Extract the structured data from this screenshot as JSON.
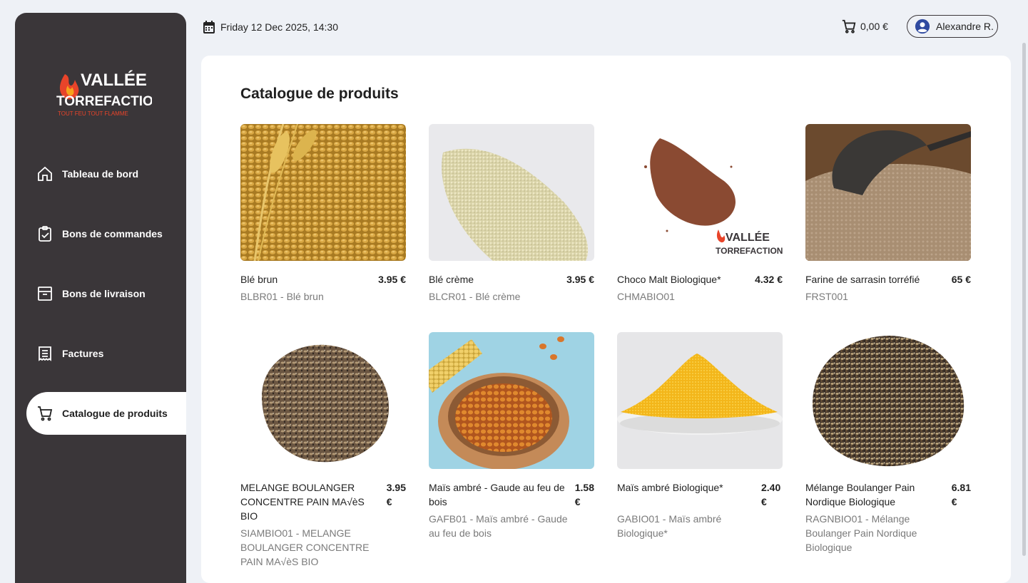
{
  "header": {
    "date": "Friday 12 Dec 2025, 14:30",
    "cart_total": "0,00 €",
    "user_name": "Alexandre R."
  },
  "brand": {
    "line1": "VALLÉE",
    "line2": "TORREFACTION",
    "tagline": "TOUT FEU TOUT FLAMME"
  },
  "sidebar": {
    "items": [
      {
        "label": "Tableau de bord",
        "icon": "home-icon"
      },
      {
        "label": "Bons de commandes",
        "icon": "clipboard-check-icon"
      },
      {
        "label": "Bons de livraison",
        "icon": "archive-box-icon"
      },
      {
        "label": "Factures",
        "icon": "receipt-icon"
      },
      {
        "label": "Catalogue de produits",
        "icon": "cart-icon",
        "active": true
      }
    ]
  },
  "page": {
    "title": "Catalogue de produits"
  },
  "products": [
    {
      "name": "Blé brun",
      "price": "3.95 €",
      "ref": "BLBR01 - Blé brun",
      "image": "golden-wheat-grains"
    },
    {
      "name": "Blé crème",
      "price": "3.95 €",
      "ref": "BLCR01 - Blé crème",
      "image": "cream-wheat-semolina"
    },
    {
      "name": "Choco Malt Biologique*",
      "price": "4.32 €",
      "ref": "CHMABIO01",
      "image": "cocoa-malt-powder"
    },
    {
      "name": "Farine de sarrasin torréfié",
      "price": "65 €",
      "ref": "FRST001",
      "image": "buckwheat-flour"
    },
    {
      "name": "MELANGE BOULANGER CONCENTRE PAIN MA√èS BIO",
      "price": "3.95 €",
      "ref": "SIAMBIO01 - MELANGE BOULANGER CONCENTRE PAIN MA√èS BIO",
      "image": "seed-mix-pile"
    },
    {
      "name": "Maïs ambré - Gaude au feu de bois",
      "price": "1.58 €",
      "ref": "GAFB01 - Maïs ambré - Gaude au feu de bois",
      "image": "roasted-corn-bowl"
    },
    {
      "name": "Maïs ambré Biologique*",
      "price": "2.40 €",
      "ref": "GABIO01 - Maïs ambré Biologique*",
      "image": "yellow-cornmeal"
    },
    {
      "name": "Mélange Boulanger Pain Nordique Biologique",
      "price": "6.81 €",
      "ref": "RAGNBIO01 - Mélange Boulanger Pain Nordique Biologique",
      "image": "nordic-seed-mix"
    }
  ],
  "colors": {
    "sidebar": "#3a3639",
    "background": "#eef1f6",
    "user_icon": "#2f4aa0",
    "flame": "#e8442a"
  }
}
